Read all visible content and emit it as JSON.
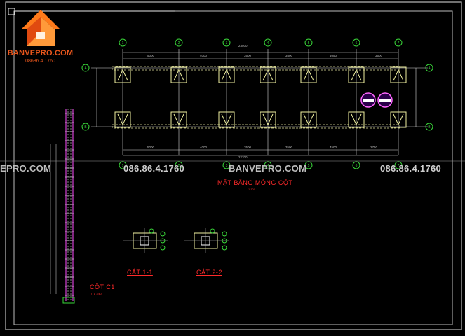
{
  "logo": {
    "name": "BANVEPRO.COM",
    "phone": "08686.4.1760"
  },
  "watermark": {
    "site": "BANVEPRO.COM",
    "left_site": "EPRO.COM",
    "phone": "086.86.4.1760"
  },
  "titles": {
    "plan": "MẶT BẰNG MÓNG CỘT",
    "plan_scale": "1:100",
    "section1": "CẮT 1-1",
    "section2": "CẮT 2-2",
    "column": "CỘT C1",
    "column_scale": "(TL 1/40)"
  },
  "axes": {
    "numbered": [
      "1",
      "2",
      "3",
      "4",
      "5",
      "6",
      "7"
    ],
    "lettered": [
      "A",
      "B"
    ]
  },
  "colors": {
    "background": "#000000",
    "grid_bubble": "#39d639",
    "footing": "#f0f0a0",
    "title_text": "#ff2a2a",
    "column_rebar": "#ff4dff",
    "logo": "#e8561c"
  }
}
